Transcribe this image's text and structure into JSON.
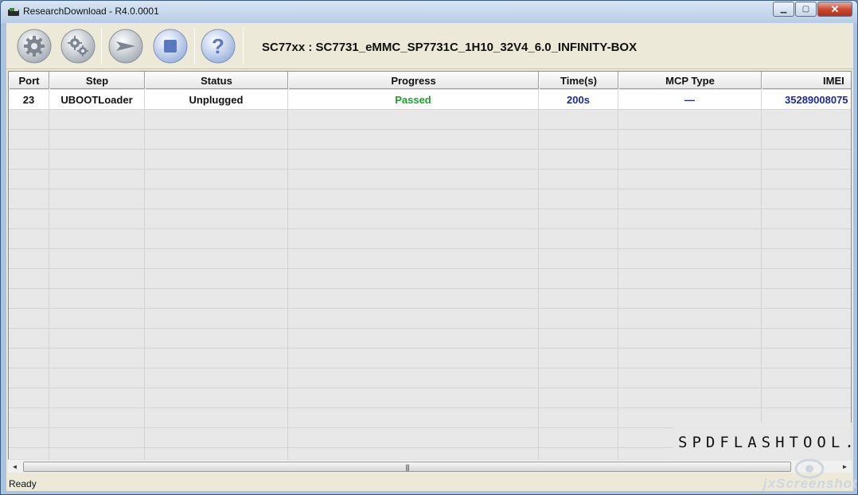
{
  "window": {
    "title": "ResearchDownload - R4.0.0001",
    "minimize": "▁",
    "maximize": "▢",
    "close": "✕"
  },
  "toolbar": {
    "firmware_title": "SC77xx : SC7731_eMMC_SP7731C_1H10_32V4_6.0_INFINITY-BOX",
    "buttons": [
      {
        "name": "load-packet-button",
        "icon": "gear-icon"
      },
      {
        "name": "settings-button",
        "icon": "gears-icon"
      },
      {
        "name": "start-download-button",
        "icon": "arrow-right-icon"
      },
      {
        "name": "stop-download-button",
        "icon": "stop-icon"
      },
      {
        "name": "help-button",
        "icon": "question-icon",
        "glyph": "?"
      }
    ]
  },
  "grid": {
    "columns": [
      "Port",
      "Step",
      "Status",
      "Progress",
      "Time(s)",
      "MCP Type",
      "IMEI"
    ],
    "rows": [
      {
        "port": "23",
        "step": "UBOOTLoader",
        "status": "Unplugged",
        "progress": "Passed",
        "time": "200s",
        "mcp": "—",
        "imei": "35289008075"
      }
    ]
  },
  "scrollbar": {
    "left": "◄",
    "right": "►",
    "grip": "|||"
  },
  "status": {
    "text": "Ready"
  },
  "watermarks": {
    "site": "SPDFLASHTOOL.COM",
    "jx": "jxScreenshot"
  },
  "colors": {
    "passed": "#1aa12a",
    "blue_text": "#1a2aa0"
  }
}
